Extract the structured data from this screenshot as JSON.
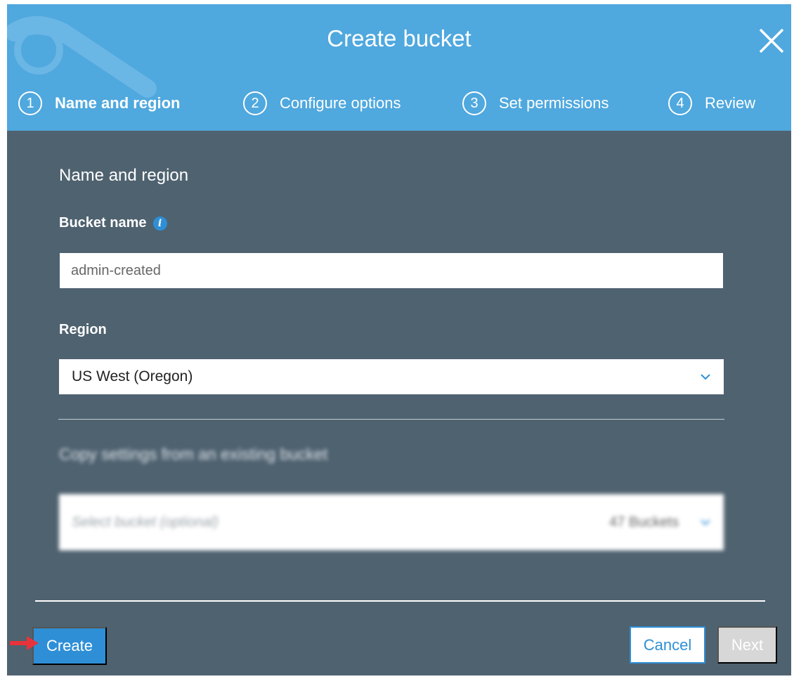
{
  "dialog": {
    "title": "Create bucket",
    "close_icon": "close-icon"
  },
  "steps": [
    {
      "number": "1",
      "label": "Name and region",
      "active": true
    },
    {
      "number": "2",
      "label": "Configure options",
      "active": false
    },
    {
      "number": "3",
      "label": "Set permissions",
      "active": false
    },
    {
      "number": "4",
      "label": "Review",
      "active": false
    }
  ],
  "form": {
    "section_title": "Name and region",
    "bucket_name_label": "Bucket name",
    "info_icon": "info-icon",
    "bucket_name_value": "admin-created",
    "region_label": "Region",
    "region_value": "US West (Oregon)",
    "copy_settings_title": "Copy settings from an existing bucket",
    "copy_select_placeholder": "Select bucket (optional)",
    "copy_select_count": "47 Buckets"
  },
  "footer": {
    "create_label": "Create",
    "cancel_label": "Cancel",
    "next_label": "Next"
  },
  "colors": {
    "header_bg": "#4fa8de",
    "body_bg": "#4f6270",
    "accent": "#2e8fd6",
    "disabled": "#d7d7d7",
    "annotation_arrow": "#e8333a"
  }
}
